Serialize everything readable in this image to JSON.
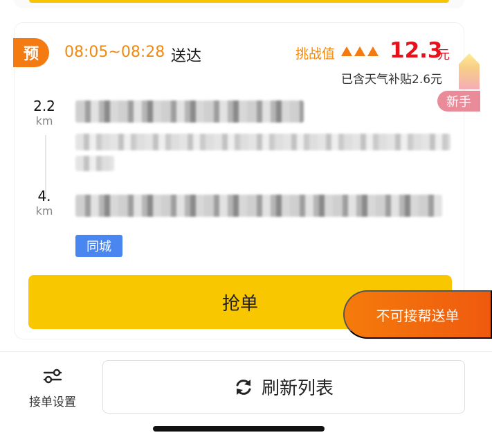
{
  "order": {
    "pre_badge": "预",
    "time_range": "08:05~08:28",
    "time_suffix": "送达",
    "challenge_label": "挑战值",
    "price": "12.3",
    "price_unit": "元",
    "subsidy_text": "已含天气补贴2.6元",
    "newbie_tag": "新手",
    "pickup": {
      "distance": "2.2",
      "unit": "km"
    },
    "dropoff": {
      "distance": "4.",
      "unit": "km"
    },
    "city_tag": "同城",
    "grab_label": "抢单",
    "help_label": "不可接帮送单"
  },
  "footer": {
    "settings_label": "接单设置",
    "refresh_label": "刷新列表"
  },
  "colors": {
    "accent_orange": "#f08a12",
    "price_red": "#e8111b",
    "grab_yellow": "#f9c700",
    "city_blue": "#4a86f0"
  }
}
